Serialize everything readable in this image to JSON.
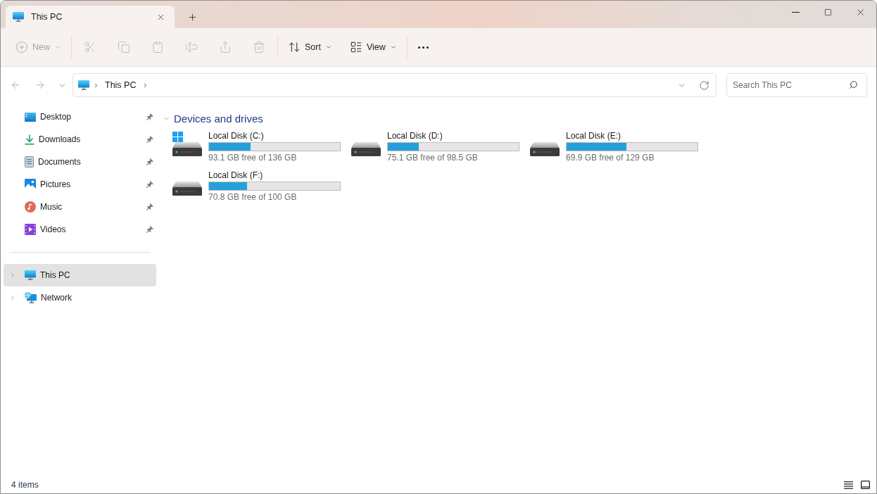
{
  "window": {
    "tabs": [
      {
        "title": "This PC",
        "selected": true
      }
    ]
  },
  "toolbar": {
    "new": {
      "label": "New",
      "disabled": true
    },
    "actions": [
      {
        "kind": "cut",
        "disabled": true
      },
      {
        "kind": "copy",
        "disabled": true
      },
      {
        "kind": "paste",
        "disabled": true
      },
      {
        "kind": "rename",
        "disabled": true
      },
      {
        "kind": "share",
        "disabled": true
      },
      {
        "kind": "delete",
        "disabled": true
      }
    ],
    "sort": {
      "label": "Sort",
      "disabled": false
    },
    "view": {
      "label": "View",
      "disabled": false
    }
  },
  "navigation": {
    "back": {
      "disabled": true
    },
    "forward": {
      "disabled": true
    }
  },
  "address_bar": {
    "path": [
      {
        "label": "This PC"
      }
    ]
  },
  "search": {
    "placeholder": "Search This PC"
  },
  "sidebar": {
    "quick_access": [
      {
        "label": "Desktop",
        "kind": "desktop",
        "pinned": true,
        "selected": false
      },
      {
        "label": "Downloads",
        "kind": "downloads",
        "pinned": true,
        "selected": false
      },
      {
        "label": "Documents",
        "kind": "documents",
        "pinned": true,
        "selected": false
      },
      {
        "label": "Pictures",
        "kind": "pictures",
        "pinned": true,
        "selected": false
      },
      {
        "label": "Music",
        "kind": "music",
        "pinned": true,
        "selected": false
      },
      {
        "label": "Videos",
        "kind": "videos",
        "pinned": true,
        "selected": false
      }
    ],
    "tree": [
      {
        "label": "This PC",
        "kind": "pc",
        "expanded": false,
        "selected": true
      },
      {
        "label": "Network",
        "kind": "network",
        "expanded": false,
        "selected": false
      }
    ]
  },
  "content": {
    "sections": [
      {
        "title": "Devices and drives",
        "expanded": true,
        "drives": [
          {
            "name": "Local Disk (C:)",
            "kind": "system",
            "level": 0.315,
            "free": "93.1 GB free of 136 GB"
          },
          {
            "name": "Local Disk (D:)",
            "kind": "local",
            "level": 0.238,
            "free": "75.1 GB free of 98.5 GB"
          },
          {
            "name": "Local Disk (E:)",
            "kind": "local",
            "level": 0.458,
            "free": "69.9 GB free of 129 GB"
          },
          {
            "name": "Local Disk (F:)",
            "kind": "local",
            "level": 0.292,
            "free": "70.8 GB free of 100 GB"
          }
        ]
      }
    ]
  },
  "status_bar": {
    "item_count": "4 items"
  }
}
